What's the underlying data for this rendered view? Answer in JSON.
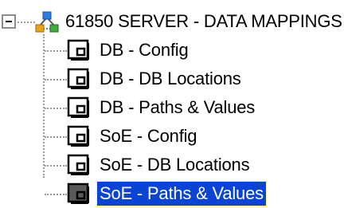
{
  "tree": {
    "root": {
      "label": "61850 SERVER - DATA MAPPINGS",
      "icon": "network-server-icon",
      "expanded": true
    },
    "items": [
      {
        "label": "DB - Config",
        "icon": "document-icon",
        "selected": false
      },
      {
        "label": "DB - DB Locations",
        "icon": "document-icon",
        "selected": false
      },
      {
        "label": "DB - Paths & Values",
        "icon": "document-icon",
        "selected": false
      },
      {
        "label": "SoE - Config",
        "icon": "document-icon",
        "selected": false
      },
      {
        "label": "SoE - DB Locations",
        "icon": "document-icon",
        "selected": false
      },
      {
        "label": "SoE - Paths & Values",
        "icon": "document-icon",
        "selected": true
      }
    ],
    "colors": {
      "selection_bg": "#0a44d6",
      "selection_text": "#ffffff",
      "connector": "#9a9a9a"
    }
  }
}
